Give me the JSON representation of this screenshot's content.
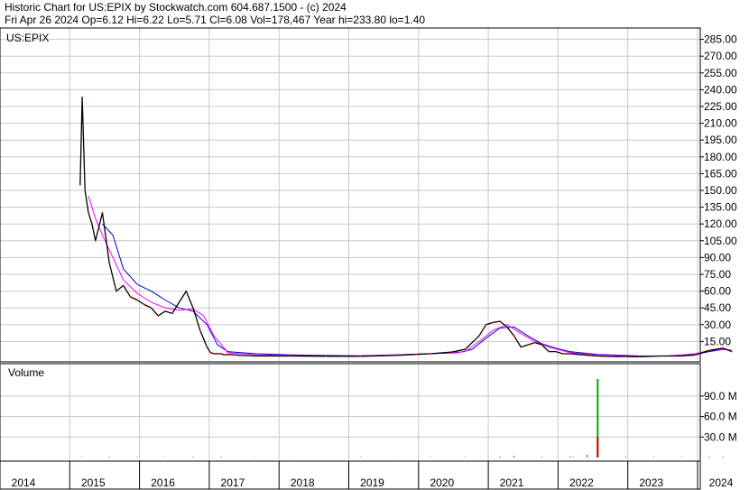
{
  "header": {
    "line1": "Historic Chart for US:EPIX by Stockwatch.com 604.687.1500 - (c) 2024",
    "line2": "Fri Apr 26 2024  Op=6.12  Hi=6.22  Lo=5.71  Cl=6.08  Vol=178,467  Year hi=233.80  lo=1.40"
  },
  "colors": {
    "price": "#000000",
    "ma_short": "#ff00ff",
    "ma_long": "#0000cc",
    "candle_down": "#cc0000",
    "volume_spike": "#00aa00",
    "grid": "#c8c8c8"
  },
  "chart_data": [
    {
      "type": "line",
      "title": "US:EPIX",
      "ylim": [
        0,
        295
      ],
      "y_ticks": [
        "285.00",
        "270.00",
        "255.00",
        "240.00",
        "225.00",
        "210.00",
        "195.00",
        "180.00",
        "165.00",
        "150.00",
        "135.00",
        "120.00",
        "105.00",
        "90.00",
        "75.00",
        "60.00",
        "45.00",
        "30.00",
        "15.00"
      ],
      "x_ticks": [
        "2014",
        "2015",
        "2016",
        "2017",
        "2018",
        "2019",
        "2020",
        "2021",
        "2022",
        "2023",
        "2024"
      ],
      "grid": true,
      "series": [
        {
          "role": "price",
          "x": [
            2014.98,
            2015.01,
            2015.05,
            2015.1,
            2015.15,
            2015.2,
            2015.3,
            2015.4,
            2015.5,
            2015.6,
            2015.7,
            2015.8,
            2015.9,
            2016.0,
            2016.1,
            2016.2,
            2016.3,
            2016.4,
            2016.5,
            2016.6,
            2016.7,
            2016.8,
            2016.85,
            2016.9,
            2016.95,
            2017.0,
            2017.05,
            2017.1,
            2017.2,
            2017.3,
            2017.5,
            2018.0,
            2018.5,
            2019.0,
            2019.5,
            2019.8,
            2020.0,
            2020.3,
            2020.5,
            2020.7,
            2020.8,
            2020.9,
            2021.0,
            2021.1,
            2021.2,
            2021.3,
            2021.4,
            2021.5,
            2021.6,
            2021.7,
            2021.8,
            2021.9,
            2022.0,
            2022.2,
            2022.4,
            2022.6,
            2022.8,
            2023.0,
            2023.3,
            2023.6,
            2023.8,
            2024.0,
            2024.2,
            2024.32
          ],
          "values": [
            155,
            233,
            150,
            130,
            120,
            105,
            130,
            85,
            60,
            65,
            55,
            52,
            48,
            45,
            38,
            42,
            40,
            50,
            60,
            45,
            25,
            10,
            5,
            4,
            4,
            4,
            3,
            3.5,
            3,
            2.5,
            2,
            2,
            1.8,
            1.8,
            2.5,
            3.5,
            4,
            5.5,
            8,
            20,
            30,
            32,
            33,
            28,
            20,
            10,
            12,
            14,
            12,
            6,
            6,
            4,
            4,
            3,
            2,
            1.5,
            1.5,
            1.4,
            2,
            2,
            3,
            7,
            9,
            6.08
          ]
        },
        {
          "role": "ma_short",
          "x": [
            2015.1,
            2015.2,
            2015.3,
            2015.45,
            2015.6,
            2015.8,
            2016.0,
            2016.2,
            2016.4,
            2016.6,
            2016.75,
            2016.9,
            2017.1,
            2017.5,
            2018.0,
            2018.5,
            2019.0,
            2019.5,
            2020.0,
            2020.5,
            2020.7,
            2020.9,
            2021.1,
            2021.3,
            2021.5,
            2021.7,
            2022.0,
            2022.4,
            2022.8,
            2023.0,
            2023.4,
            2023.8,
            2024.0,
            2024.2,
            2024.32
          ],
          "values": [
            145,
            125,
            110,
            90,
            70,
            58,
            50,
            45,
            43,
            44,
            38,
            20,
            5,
            3,
            2.5,
            2,
            2,
            3,
            4,
            6,
            15,
            25,
            30,
            22,
            15,
            10,
            5,
            3,
            2,
            1.8,
            2,
            4,
            7,
            8,
            7
          ]
        },
        {
          "role": "ma_long",
          "x": [
            2015.3,
            2015.45,
            2015.6,
            2015.8,
            2016.0,
            2016.2,
            2016.4,
            2016.6,
            2016.8,
            2016.95,
            2017.1,
            2017.5,
            2018.0,
            2018.5,
            2019.0,
            2019.5,
            2020.0,
            2020.4,
            2020.6,
            2020.8,
            2021.0,
            2021.2,
            2021.4,
            2021.6,
            2021.8,
            2022.0,
            2022.4,
            2022.8,
            2023.0,
            2023.4,
            2023.8,
            2024.0,
            2024.2,
            2024.32
          ],
          "values": [
            120,
            110,
            80,
            66,
            60,
            52,
            45,
            42,
            30,
            12,
            6,
            4,
            3,
            2.5,
            2.2,
            3,
            4,
            5,
            8,
            18,
            27,
            28,
            20,
            13,
            9,
            6,
            3.5,
            2.5,
            2,
            2,
            3.5,
            6,
            8,
            7
          ]
        }
      ]
    },
    {
      "type": "bar",
      "title": "Volume",
      "ylim": [
        0,
        110
      ],
      "y_ticks": [
        "90.0 M",
        "60.0 M",
        "30.0 M"
      ],
      "grid": true,
      "x": [
        2015.0,
        2015.4,
        2015.8,
        2016.2,
        2016.6,
        2017.0,
        2017.5,
        2018.0,
        2018.5,
        2019.0,
        2019.5,
        2020.0,
        2020.5,
        2021.0,
        2021.2,
        2021.6,
        2022.0,
        2022.05,
        2022.25,
        2022.4,
        2022.8,
        2023.2,
        2023.6,
        2024.0,
        2024.2
      ],
      "values": [
        0.8,
        1.0,
        0.9,
        0.7,
        0.8,
        1.0,
        0.6,
        0.5,
        0.5,
        0.6,
        0.5,
        0.7,
        0.8,
        1.5,
        2.5,
        1.0,
        1.2,
        1.0,
        4.0,
        115,
        1.2,
        0.8,
        0.7,
        1.0,
        1.1
      ]
    }
  ]
}
